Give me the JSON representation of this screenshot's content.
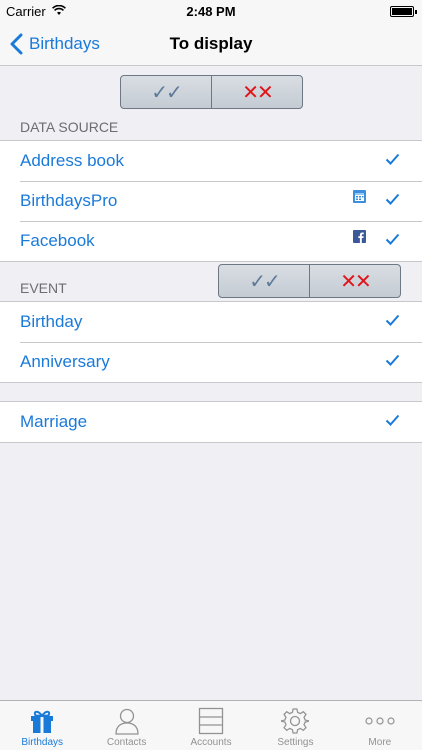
{
  "status_bar": {
    "carrier": "Carrier",
    "time": "2:48 PM"
  },
  "nav": {
    "back_label": "Birthdays",
    "title": "To display"
  },
  "segment": {
    "check_all": "✓✓",
    "uncheck_all": "✕✕"
  },
  "data_source": {
    "header": "DATA SOURCE",
    "items": [
      {
        "label": "Address book",
        "icon": "",
        "checked": true
      },
      {
        "label": "BirthdaysPro",
        "icon": "birthdayspro-icon",
        "checked": true
      },
      {
        "label": "Facebook",
        "icon": "facebook-icon",
        "checked": true
      }
    ]
  },
  "event": {
    "header": "EVENT",
    "items": [
      {
        "label": "Birthday",
        "checked": true
      },
      {
        "label": "Anniversary",
        "checked": true
      }
    ]
  },
  "other": {
    "items": [
      {
        "label": "Marriage",
        "checked": true
      }
    ]
  },
  "tabs": [
    {
      "label": "Birthdays",
      "icon": "gift-icon",
      "active": true
    },
    {
      "label": "Contacts",
      "icon": "person-icon",
      "active": false
    },
    {
      "label": "Accounts",
      "icon": "accounts-icon",
      "active": false
    },
    {
      "label": "Settings",
      "icon": "gear-icon",
      "active": false
    },
    {
      "label": "More",
      "icon": "more-icon",
      "active": false
    }
  ],
  "colors": {
    "accent": "#1a7ad9",
    "uncheck": "#e0141a",
    "background": "#efeff4"
  }
}
